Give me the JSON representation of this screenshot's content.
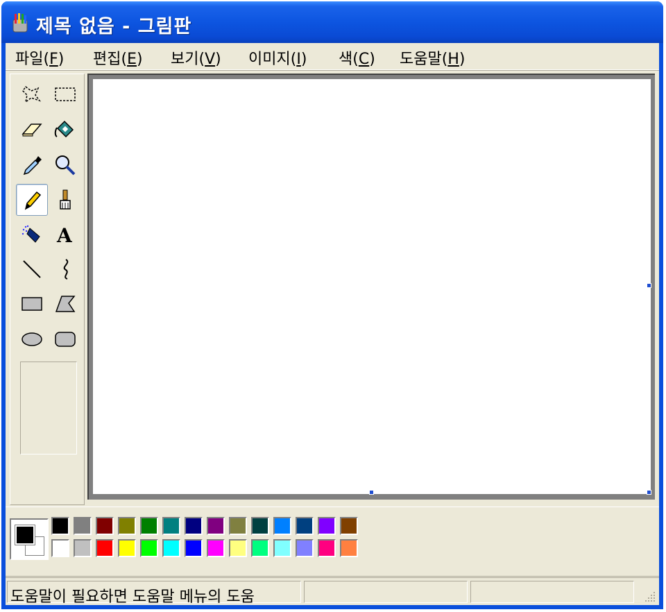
{
  "window": {
    "title": "제목 없음 - 그림판"
  },
  "menu": {
    "items": [
      {
        "label": "파일(",
        "key": "F",
        "tail": ")"
      },
      {
        "label": "편집(",
        "key": "E",
        "tail": ")"
      },
      {
        "label": "보기(",
        "key": "V",
        "tail": ")"
      },
      {
        "label": "이미지(",
        "key": "I",
        "tail": ")"
      },
      {
        "label": "색(",
        "key": "C",
        "tail": ")"
      },
      {
        "label": "도움말(",
        "key": "H",
        "tail": ")"
      }
    ]
  },
  "tools": {
    "active": "pencil",
    "items": [
      "free-form-select",
      "select",
      "eraser",
      "fill-with-color",
      "pick-color",
      "magnifier",
      "pencil",
      "brush",
      "airbrush",
      "text",
      "line",
      "curve",
      "rectangle",
      "polygon",
      "ellipse",
      "rounded-rectangle"
    ]
  },
  "colors": {
    "foreground": "#000000",
    "background": "#ffffff",
    "palette_top": [
      "#000000",
      "#808080",
      "#800000",
      "#808000",
      "#008000",
      "#008080",
      "#000080",
      "#800080",
      "#808040",
      "#004040",
      "#0080ff",
      "#004080",
      "#8000ff",
      "#804000"
    ],
    "palette_bottom": [
      "#ffffff",
      "#c0c0c0",
      "#ff0000",
      "#ffff00",
      "#00ff00",
      "#00ffff",
      "#0000ff",
      "#ff00ff",
      "#ffff80",
      "#00ff80",
      "#80ffff",
      "#8080ff",
      "#ff0080",
      "#ff8040"
    ]
  },
  "status": {
    "text": "도움말이 필요하면 도움말 메뉴의 도움"
  }
}
